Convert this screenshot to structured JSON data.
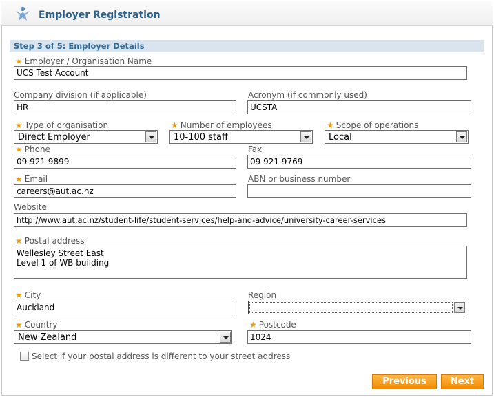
{
  "header": {
    "title": "Employer Registration",
    "logo_icon": "person-star-icon"
  },
  "step": {
    "text": "Step 3 of 5: Employer Details"
  },
  "fields": {
    "org_name": {
      "label": "Employer / Organisation Name",
      "value": "UCS Test Account",
      "required": true
    },
    "division": {
      "label": "Company division (if applicable)",
      "value": "HR",
      "required": false
    },
    "acronym": {
      "label": "Acronym (if commonly used)",
      "value": "UCSTA",
      "required": false
    },
    "org_type": {
      "label": "Type of organisation",
      "value": "Direct Employer",
      "required": true
    },
    "num_employees": {
      "label": "Number of employees",
      "value": "10-100 staff",
      "required": true
    },
    "scope": {
      "label": "Scope of operations",
      "value": "Local",
      "required": true
    },
    "phone": {
      "label": "Phone",
      "value": "09 921 9899",
      "required": true
    },
    "fax": {
      "label": "Fax",
      "value": "09 921 9769",
      "required": false
    },
    "email": {
      "label": "Email",
      "value": "careers@aut.ac.nz",
      "required": true
    },
    "abn": {
      "label": "ABN or business number",
      "value": "",
      "required": false
    },
    "website": {
      "label": "Website",
      "value": "http://www.aut.ac.nz/student-life/student-services/help-and-advice/university-career-services",
      "required": false
    },
    "postal_address": {
      "label": "Postal address",
      "value": "Wellesley Street East\nLevel 1 of WB building",
      "required": true
    },
    "city": {
      "label": "City",
      "value": "Auckland",
      "required": true
    },
    "region": {
      "label": "Region",
      "value": "",
      "required": false
    },
    "country": {
      "label": "Country",
      "value": "New Zealand",
      "required": true
    },
    "postcode": {
      "label": "Postcode",
      "value": "1024",
      "required": true
    }
  },
  "checkbox": {
    "label": "Select if your postal address is different to your street address",
    "checked": false
  },
  "buttons": {
    "previous": "Previous",
    "next": "Next"
  },
  "colors": {
    "accent": "#2b5f8c",
    "required_star": "#f29a00",
    "button": "#f28a00",
    "step_bar": "#d9e4ee"
  }
}
